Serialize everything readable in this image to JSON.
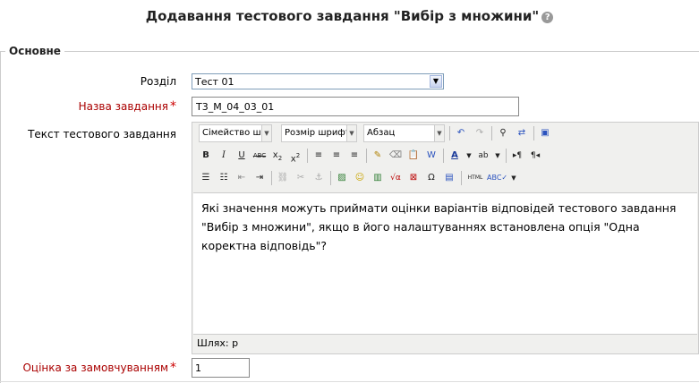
{
  "title": "Додавання тестового завдання \"Вибір з множини\"",
  "section_legend": "Основне",
  "fields": {
    "category_label": "Розділ",
    "category_value": "Тест 01",
    "name_label": "Назва завдання",
    "name_value": "T3_M_04_03_01",
    "text_label": "Текст тестового завдання",
    "grade_label": "Оцінка за замовчуванням",
    "grade_value": "1"
  },
  "editor": {
    "font_family": "Сімейство шри",
    "font_size": "Розмір шрифта",
    "format": "Абзац",
    "content": "Які значення можуть приймати оцінки варіантів відповідей тестового завдання \"Вибір з множини\", якщо в його налаштуваннях встановлена опція \"Одна коректна відповідь\"?",
    "path": "Шлях: p"
  }
}
